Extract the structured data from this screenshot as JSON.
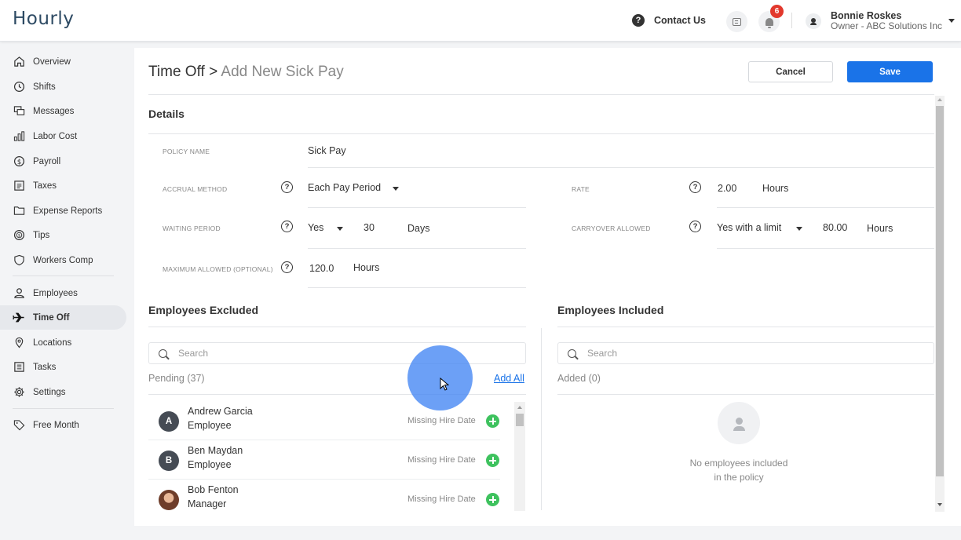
{
  "app": {
    "logo": "Hourly"
  },
  "header": {
    "contact_label": "Contact Us",
    "notification_count": "6",
    "user_name": "Bonnie Roskes",
    "user_role": "Owner - ABC Solutions Inc"
  },
  "sidebar": {
    "items": [
      {
        "label": "Overview",
        "icon": "home-icon"
      },
      {
        "label": "Shifts",
        "icon": "clock-icon"
      },
      {
        "label": "Messages",
        "icon": "messages-icon"
      },
      {
        "label": "Labor Cost",
        "icon": "bar-chart-icon"
      },
      {
        "label": "Payroll",
        "icon": "dollar-circle-icon"
      },
      {
        "label": "Taxes",
        "icon": "document-icon"
      },
      {
        "label": "Expense Reports",
        "icon": "folder-icon"
      },
      {
        "label": "Tips",
        "icon": "tips-icon"
      },
      {
        "label": "Workers Comp",
        "icon": "shield-icon"
      },
      {
        "label": "Employees",
        "icon": "person-icon"
      },
      {
        "label": "Time Off",
        "icon": "airplane-icon",
        "active": true
      },
      {
        "label": "Locations",
        "icon": "location-pin-icon"
      },
      {
        "label": "Tasks",
        "icon": "tasks-icon"
      },
      {
        "label": "Settings",
        "icon": "gear-icon"
      },
      {
        "label": "Free Month",
        "icon": "tag-icon"
      }
    ]
  },
  "page": {
    "breadcrumb_parent": "Time Off >",
    "title": "Add New Sick Pay",
    "cancel_label": "Cancel",
    "save_label": "Save"
  },
  "details": {
    "section_title": "Details",
    "policy_name_label": "POLICY NAME",
    "policy_name_value": "Sick Pay",
    "accrual_method_label": "ACCRUAL METHOD",
    "accrual_method_value": "Each Pay Period",
    "rate_label": "RATE",
    "rate_value": "2.00",
    "rate_unit": "Hours",
    "waiting_period_label": "WAITING PERIOD",
    "waiting_period_value": "Yes",
    "waiting_period_days": "30",
    "waiting_period_unit": "Days",
    "carryover_label": "CARRYOVER ALLOWED",
    "carryover_value": "Yes with a limit",
    "carryover_amount": "80.00",
    "carryover_unit": "Hours",
    "max_allowed_label": "MAXIMUM ALLOWED (OPTIONAL)",
    "max_allowed_value": "120.0",
    "max_allowed_unit": "Hours"
  },
  "excluded": {
    "title": "Employees Excluded",
    "search_placeholder": "Search",
    "pending_label": "Pending (37)",
    "add_all_label": "Add All",
    "employees": [
      {
        "initial": "A",
        "name": "Andrew Garcia",
        "role": "Employee",
        "status": "Missing Hire Date"
      },
      {
        "initial": "B",
        "name": "Ben Maydan",
        "role": "Employee",
        "status": "Missing Hire Date"
      },
      {
        "initial": "",
        "name": "Bob Fenton",
        "role": "Manager",
        "status": "Missing Hire Date"
      }
    ]
  },
  "included": {
    "title": "Employees Included",
    "search_placeholder": "Search",
    "added_label": "Added (0)",
    "empty_line1": "No employees included",
    "empty_line2": "in the policy"
  }
}
